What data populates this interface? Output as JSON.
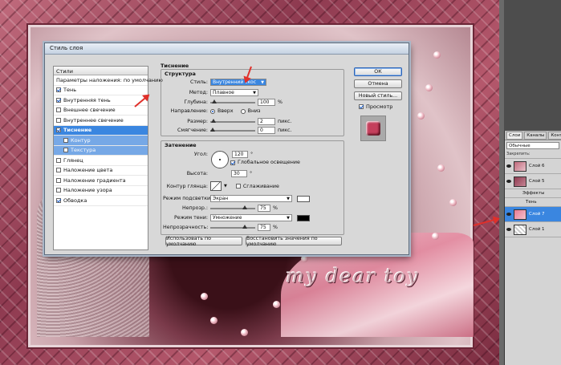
{
  "dialog": {
    "title": "Стиль слоя",
    "list_header": "Стили",
    "blend_options": "Параметры наложения: по умолчанию",
    "styles": [
      {
        "label": "Тень",
        "checked": true
      },
      {
        "label": "Внутренняя тень",
        "checked": true
      },
      {
        "label": "Внешнее свечение",
        "checked": false
      },
      {
        "label": "Внутреннее свечение",
        "checked": false
      },
      {
        "label": "Тиснение",
        "checked": true,
        "selected": true
      },
      {
        "label": "Контур",
        "checked": false,
        "sub": true
      },
      {
        "label": "Текстура",
        "checked": false,
        "sub": true
      },
      {
        "label": "Глянец",
        "checked": false
      },
      {
        "label": "Наложение цвета",
        "checked": false
      },
      {
        "label": "Наложение градиента",
        "checked": false
      },
      {
        "label": "Наложение узора",
        "checked": false
      },
      {
        "label": "Обводка",
        "checked": true
      }
    ],
    "section_title": "Тиснение",
    "structure": {
      "title": "Структура",
      "style_label": "Стиль:",
      "style_value": "Внутренний скос",
      "method_label": "Метод:",
      "method_value": "Плавное",
      "depth_label": "Глубина:",
      "depth_value": "100",
      "depth_unit": "%",
      "direction_label": "Направление:",
      "dir_up": "Вверх",
      "dir_down": "Вниз",
      "size_label": "Размер:",
      "size_value": "2",
      "size_unit": "пикс.",
      "soften_label": "Смягчение:",
      "soften_value": "0",
      "soften_unit": "пикс."
    },
    "shading": {
      "title": "Затенение",
      "angle_label": "Угол:",
      "angle_value": "120",
      "angle_unit": "°",
      "global_light": "Глобальное освещение",
      "altitude_label": "Высота:",
      "altitude_value": "30",
      "altitude_unit": "°",
      "gloss_label": "Контур глянца:",
      "antialias": "Сглаживание",
      "highlight_label": "Режим подсветки:",
      "highlight_value": "Экран",
      "highlight_color": "#ffffff",
      "opacity1_label": "Непрозр.:",
      "opacity1_value": "75",
      "shadow_label": "Режим тени:",
      "shadow_value": "Умножение",
      "shadow_color": "#000000",
      "opacity2_label": "Непрозрачность:",
      "opacity2_value": "75",
      "pct": "%"
    },
    "buttons": {
      "ok": "ОК",
      "cancel": "Отмена",
      "new_style": "Новый стиль...",
      "preview": "Просмотр",
      "use_default": "Использовать по умолчанию",
      "restore_default": "Восстановить значения по умолчанию"
    }
  },
  "canvas": {
    "watermark": "my dear toy"
  },
  "layers": {
    "tabs": [
      "Слои",
      "Каналы",
      "Конт"
    ],
    "blend": "Обычные",
    "lock": "Закрепить:",
    "items": [
      {
        "name": "Слой 6",
        "active": false
      },
      {
        "name": "Слой 5",
        "active": false
      },
      {
        "name": "Эффекты",
        "fx": true
      },
      {
        "name": "Тень",
        "fx2": true
      },
      {
        "name": "Слой 7",
        "active": true
      },
      {
        "name": "Слой 1",
        "active": false
      }
    ]
  },
  "colors": {
    "selection": "#3a86e0",
    "annotation_arrow": "#e0302a"
  }
}
